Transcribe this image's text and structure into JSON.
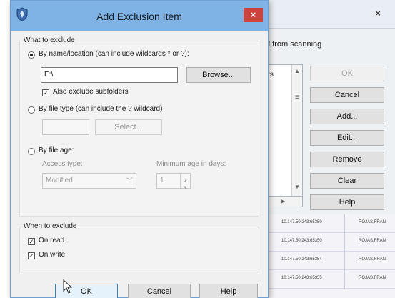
{
  "background_window": {
    "close_glyph": "×",
    "scanning_text": "d from scanning",
    "list_header": "ers",
    "buttons": [
      {
        "label": "OK",
        "enabled": false
      },
      {
        "label": "Cancel",
        "enabled": true
      },
      {
        "label": "Add...",
        "enabled": true
      },
      {
        "label": "Edit...",
        "enabled": true
      },
      {
        "label": "Remove",
        "enabled": true
      },
      {
        "label": "Clear",
        "enabled": true
      },
      {
        "label": "Help",
        "enabled": true
      }
    ],
    "table_rows": [
      {
        "ip": "10.147.50.243:65350",
        "user": "ROJAS,FRAN"
      },
      {
        "ip": "10.147.50.243:65350",
        "user": "ROJAS,FRAN"
      },
      {
        "ip": "10.147.50.243:65354",
        "user": "ROJAS,FRAN"
      },
      {
        "ip": "10.147.50.243:65355",
        "user": "ROJAS,FRAN"
      }
    ]
  },
  "dialog": {
    "title": "Add Exclusion Item",
    "close_glyph": "×",
    "what_to_exclude": {
      "label": "What to exclude",
      "by_name": {
        "label": "By name/location (can include wildcards * or ?):",
        "selected": true,
        "path_value": "E:\\",
        "browse_label": "Browse...",
        "subfolders_label": "Also exclude subfolders",
        "subfolders_checked": true
      },
      "by_type": {
        "label": "By file type (can include the ? wildcard)",
        "selected": false,
        "value": "",
        "select_label": "Select..."
      },
      "by_age": {
        "label": "By file age:",
        "selected": false,
        "access_type_label": "Access type:",
        "access_type_value": "Modified",
        "min_age_label": "Minimum age in days:",
        "min_age_value": "1"
      }
    },
    "when_to_exclude": {
      "label": "When to exclude",
      "on_read_label": "On read",
      "on_read_checked": true,
      "on_write_label": "On write",
      "on_write_checked": true
    },
    "buttons": {
      "ok": "OK",
      "cancel": "Cancel",
      "help": "Help"
    }
  },
  "colors": {
    "titlebar": "#7fb3e6",
    "close": "#c8443c",
    "dialog_bg": "#f0f0f0"
  }
}
